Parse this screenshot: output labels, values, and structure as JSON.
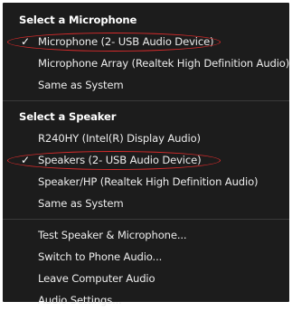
{
  "menu": {
    "microphone_section": {
      "title": "Select a Microphone",
      "items": [
        {
          "label": "Microphone (2- USB Audio Device)",
          "checked": true
        },
        {
          "label": "Microphone Array (Realtek High Definition Audio)",
          "checked": false
        },
        {
          "label": "Same as System",
          "checked": false
        }
      ]
    },
    "speaker_section": {
      "title": "Select a Speaker",
      "items": [
        {
          "label": "R240HY (Intel(R) Display Audio)",
          "checked": false
        },
        {
          "label": "Speakers (2- USB Audio Device)",
          "checked": true
        },
        {
          "label": "Speaker/HP (Realtek High Definition Audio)",
          "checked": false
        },
        {
          "label": "Same as System",
          "checked": false
        }
      ]
    },
    "actions": [
      {
        "label": "Test Speaker & Microphone..."
      },
      {
        "label": "Switch to Phone Audio..."
      },
      {
        "label": "Leave Computer Audio"
      },
      {
        "label": "Audio Settings..."
      }
    ],
    "check_glyph": "✓"
  },
  "colors": {
    "menu_background": "#1c1c1c",
    "text": "#ececec",
    "highlight_ring": "#d92b2b",
    "divider": "#3a3a3a"
  }
}
